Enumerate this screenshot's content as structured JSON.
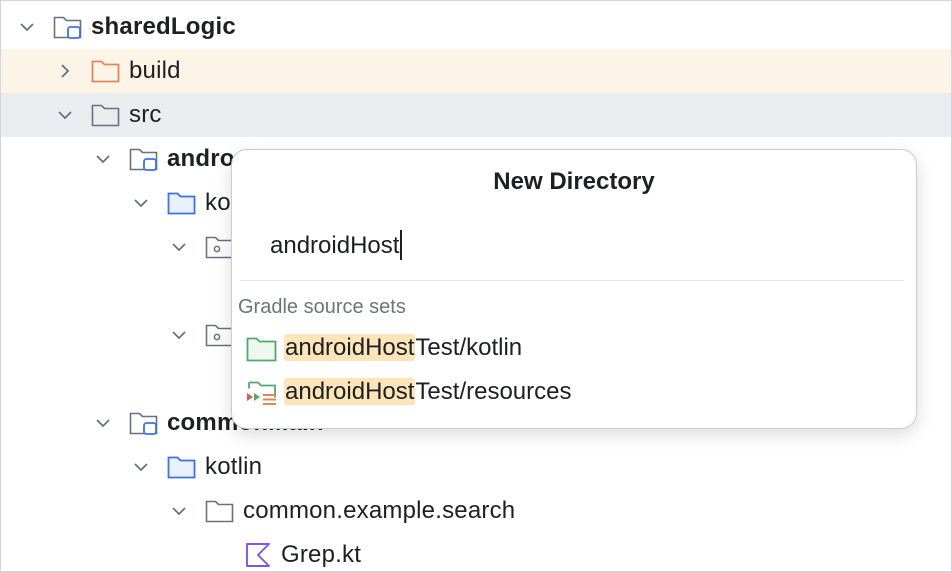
{
  "tree": {
    "items": [
      {
        "label": "sharedLogic",
        "icon": "module-folder-icon",
        "expanded": true
      },
      {
        "label": "build",
        "icon": "excluded-folder-icon",
        "expanded": false
      },
      {
        "label": "src",
        "icon": "folder-icon",
        "expanded": true
      },
      {
        "label": "andro",
        "icon": "module-folder-icon",
        "expanded": true
      },
      {
        "label": "ko",
        "icon": "source-folder-icon",
        "expanded": true
      },
      {
        "label": "",
        "icon": "package-icon",
        "expanded": true
      },
      {
        "label": "",
        "icon": "package-icon",
        "expanded": true
      },
      {
        "label": "commonMain",
        "icon": "module-folder-icon",
        "expanded": true
      },
      {
        "label": "kotlin",
        "icon": "source-folder-icon",
        "expanded": true
      },
      {
        "label": "common.example.search",
        "icon": "folder-icon",
        "expanded": true
      },
      {
        "label": "Grep.kt",
        "icon": "kotlin-file-icon"
      }
    ]
  },
  "dialog": {
    "title": "New Directory",
    "input_value": "androidHost",
    "group_label": "Gradle source sets",
    "options": [
      {
        "match": "androidHost",
        "rest": "Test/kotlin",
        "icon": "test-source-folder-icon"
      },
      {
        "match": "androidHost",
        "rest": "Test/resources",
        "icon": "test-resources-folder-icon"
      }
    ]
  },
  "colors": {
    "build_row_highlight": "#fdf4e8",
    "src_row_highlight": "#ebecf0",
    "match_highlight": "#fbe5b9",
    "source_folder_blue": "#3574f0",
    "excluded_folder_orange": "#e08855",
    "test_folder_green": "#55a76a",
    "kotlin_purple": "#7f52ff"
  }
}
